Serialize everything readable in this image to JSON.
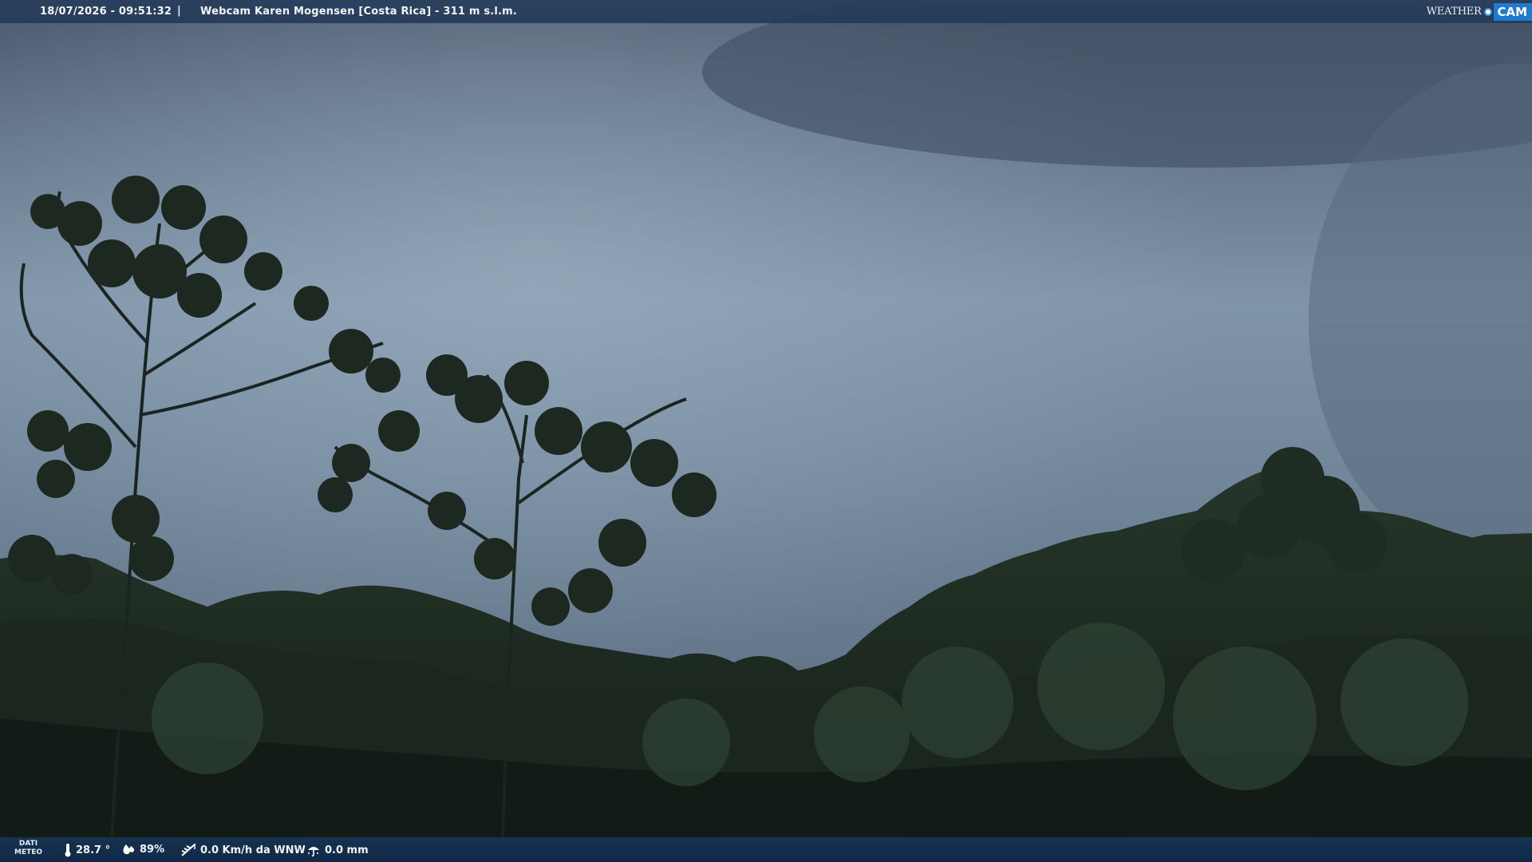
{
  "header": {
    "datetime": "18/07/2026 - 09:51:32",
    "separator": "|",
    "location": "Webcam Karen Mogensen [Costa Rica]  - 311 m s.l.m."
  },
  "logo": {
    "weather": "WEATHER",
    "cam": "CAM"
  },
  "footer": {
    "label_line1": "DATI",
    "label_line2": "METEO",
    "temperature": "28.7 °",
    "humidity": "89%",
    "wind": "0.0 Km/h da WNW",
    "rain": "0.0 mm",
    "icons": [
      "thermometer-icon",
      "humidity-icon",
      "wind-icon",
      "rain-icon"
    ]
  },
  "colors": {
    "bar_background": "#22395a",
    "logo_accent": "#1f7bd0"
  }
}
